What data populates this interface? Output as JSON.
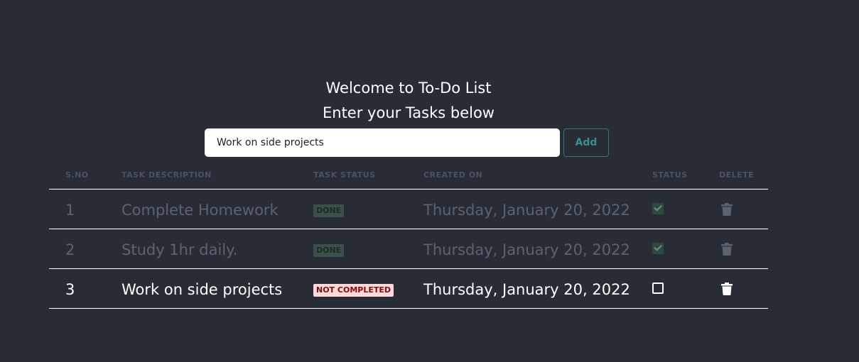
{
  "header": {
    "welcome": "Welcome to To-Do List",
    "subtitle": "Enter your Tasks below"
  },
  "form": {
    "input_value": "Work on side projects",
    "add_label": "Add"
  },
  "table": {
    "headers": {
      "sno": "S.NO",
      "description": "TASK DESCRIPTION",
      "task_status": "TASK STATUS",
      "created_on": "CREATED ON",
      "status": "STATUS",
      "delete": "DELETE"
    },
    "rows": [
      {
        "sno": "1",
        "description": "Complete Homework",
        "status_badge": "DONE",
        "created_on": "Thursday, January 20, 2022",
        "completed": true,
        "delete_icon": "trash-icon"
      },
      {
        "sno": "2",
        "description": "Study 1hr daily.",
        "status_badge": "DONE",
        "created_on": "Thursday, January 20, 2022",
        "completed": true,
        "delete_icon": "trash-icon"
      },
      {
        "sno": "3",
        "description": "Work on side projects",
        "status_badge": "NOT COMPLETED",
        "created_on": "Thursday, January 20, 2022",
        "completed": false,
        "delete_icon": "trash-icon"
      }
    ]
  },
  "colors": {
    "background": "#282c34",
    "header_text": "#4b5263",
    "done_text": "#5c6370",
    "done_badge_bg": "#3b5048",
    "not_completed_badge_bg": "#fcd8d8",
    "not_completed_badge_text": "#7a1010",
    "add_button": "#2f7a78"
  }
}
